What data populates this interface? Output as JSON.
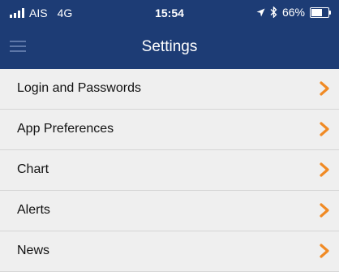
{
  "status_bar": {
    "carrier": "AIS",
    "network": "4G",
    "time": "15:54",
    "battery_label": "66%",
    "battery_level": 0.66,
    "icons": [
      "signal-icon",
      "location-icon",
      "bluetooth-icon",
      "battery-icon"
    ]
  },
  "nav": {
    "title": "Settings",
    "menu_icon": "hamburger-menu-icon"
  },
  "settings_items": [
    {
      "label": "Login and Passwords"
    },
    {
      "label": "App Preferences"
    },
    {
      "label": "Chart"
    },
    {
      "label": "Alerts"
    },
    {
      "label": "News"
    }
  ],
  "colors": {
    "header_bg": "#1d3c75",
    "list_bg": "#efefef",
    "chevron": "#f08a24",
    "divider": "#d6d6d6"
  }
}
